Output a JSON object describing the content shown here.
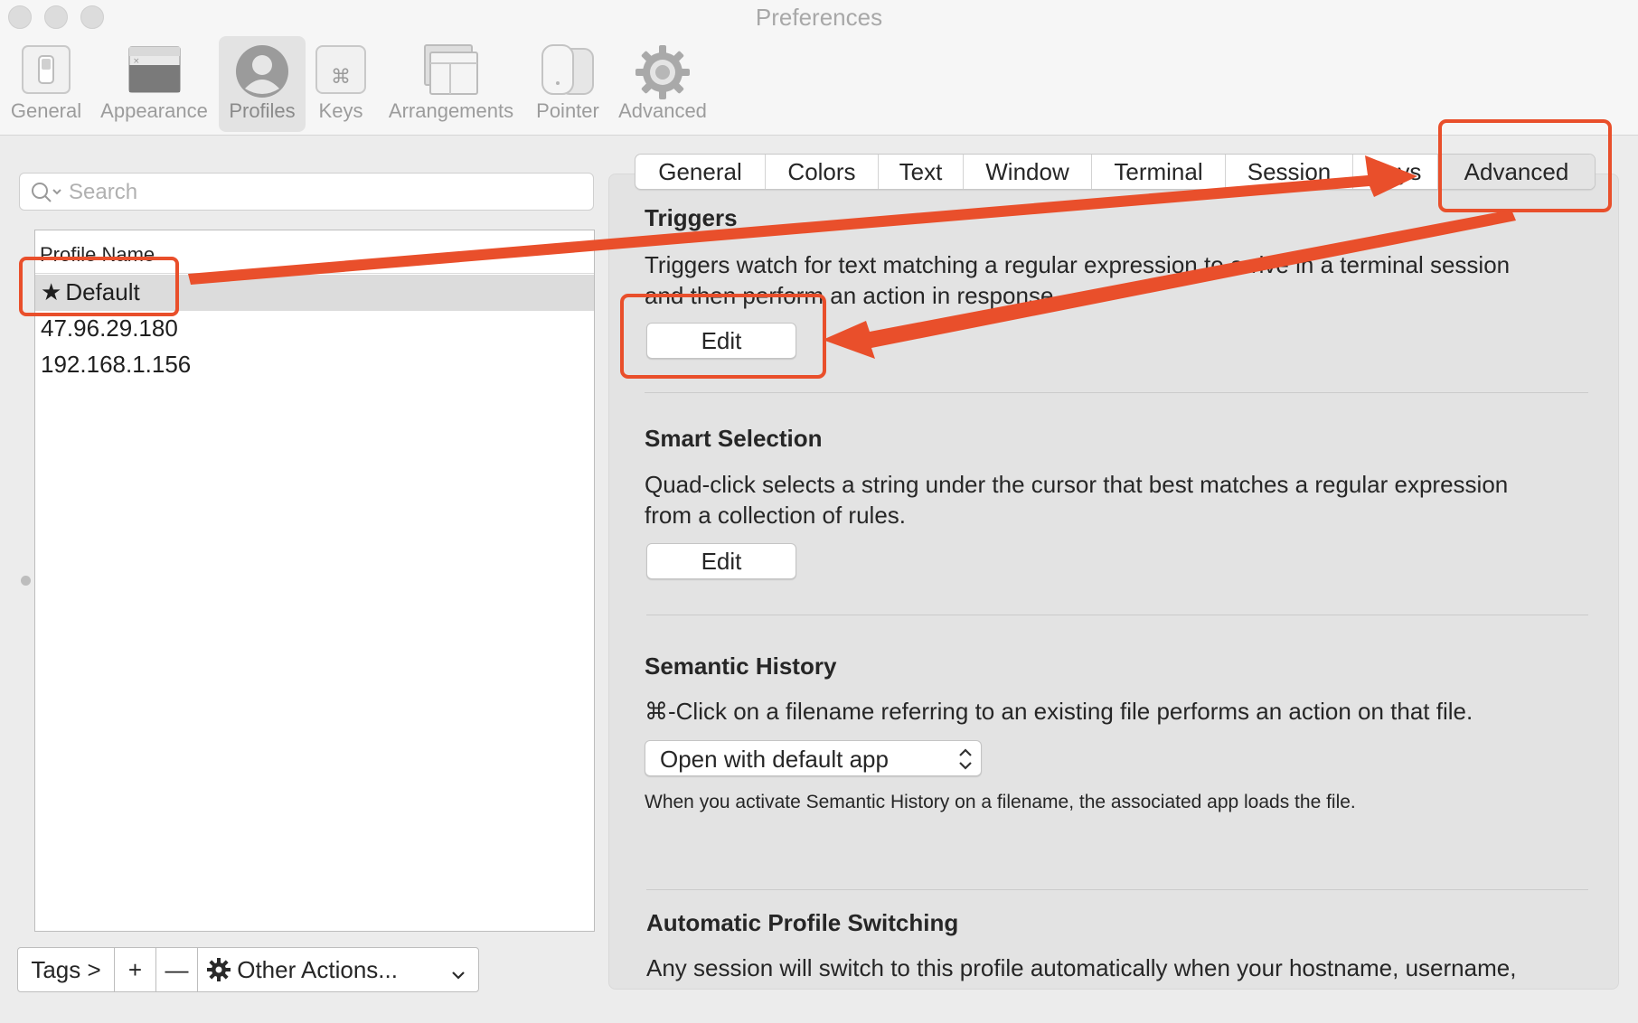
{
  "window": {
    "title": "Preferences"
  },
  "toolbar": {
    "items": [
      {
        "label": "General",
        "icon": "general-switch-icon"
      },
      {
        "label": "Appearance",
        "icon": "appearance-window-icon"
      },
      {
        "label": "Profiles",
        "icon": "profiles-person-icon",
        "selected": true
      },
      {
        "label": "Keys",
        "icon": "keys-command-icon"
      },
      {
        "label": "Arrangements",
        "icon": "arrangements-windows-icon"
      },
      {
        "label": "Pointer",
        "icon": "pointer-mouse-icon"
      },
      {
        "label": "Advanced",
        "icon": "advanced-gear-icon"
      }
    ]
  },
  "search": {
    "placeholder": "Search",
    "value": ""
  },
  "profiles": {
    "column_header": "Profile Name",
    "rows": [
      {
        "name": "Default",
        "default": true,
        "selected": true
      },
      {
        "name": "47.96.29.180"
      },
      {
        "name": "192.168.1.156"
      }
    ]
  },
  "bottom_bar": {
    "tags_label": "Tags >",
    "add_label": "+",
    "remove_label": "—",
    "other_actions_label": "Other Actions..."
  },
  "tabs": [
    {
      "label": "General"
    },
    {
      "label": "Colors"
    },
    {
      "label": "Text"
    },
    {
      "label": "Window"
    },
    {
      "label": "Terminal"
    },
    {
      "label": "Session"
    },
    {
      "label": "Keys"
    },
    {
      "label": "Advanced",
      "active": true
    }
  ],
  "sections": {
    "triggers": {
      "title": "Triggers",
      "line1": "Triggers watch for text matching a regular expression to arrive in a terminal session",
      "line2": "and then perform an action in response.",
      "button": "Edit"
    },
    "smart_selection": {
      "title": "Smart Selection",
      "line1": "Quad-click selects a string under the cursor that best matches a regular expression",
      "line2": "from a collection of rules.",
      "button": "Edit"
    },
    "semantic_history": {
      "title": "Semantic History",
      "description": "⌘-Click on a filename referring to an existing file performs an action on that file.",
      "select_value": "Open with default app",
      "note": "When you activate Semantic History on a filename, the associated app loads the file."
    },
    "auto_profile_switching": {
      "title": "Automatic Profile Switching",
      "description": "Any session will switch to this profile automatically when your hostname, username,"
    }
  },
  "colors": {
    "annotation": "#e94f2b",
    "selection_row": "#dcdcdc"
  }
}
